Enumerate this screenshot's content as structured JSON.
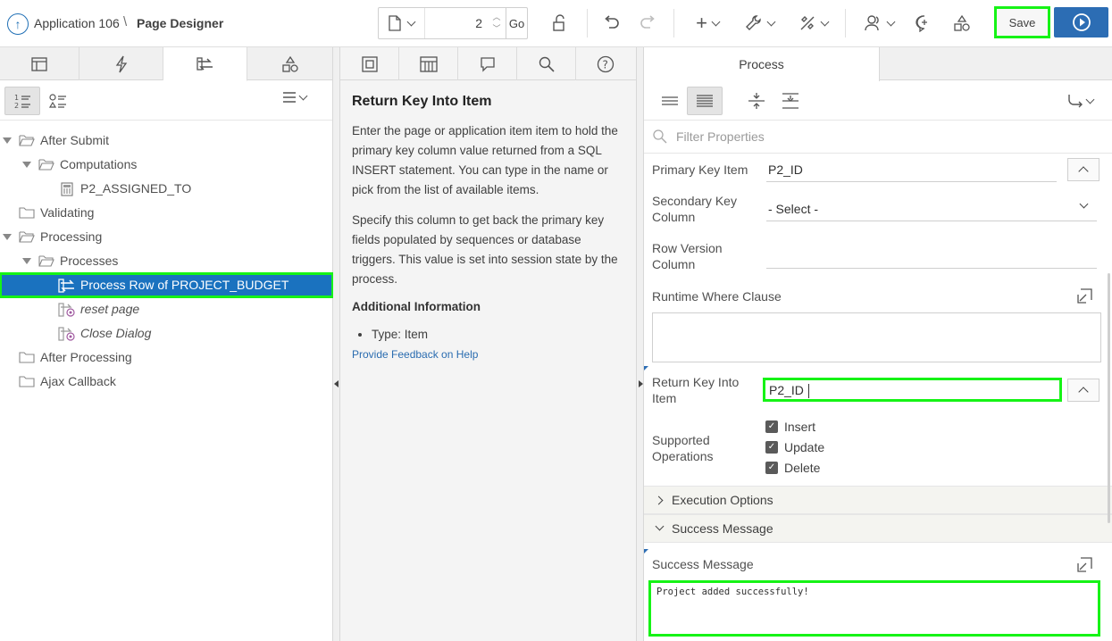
{
  "header": {
    "app_name": "Application 106",
    "separator": "\\",
    "page_title": "Page Designer",
    "page_number": "2",
    "go_label": "Go",
    "save_label": "Save"
  },
  "left": {
    "tree": [
      {
        "label": "After Submit",
        "level": 0,
        "icon": "folder-open-icon",
        "expanded": true
      },
      {
        "label": "Computations",
        "level": 1,
        "icon": "folder-open-icon",
        "expanded": true
      },
      {
        "label": "P2_ASSIGNED_TO",
        "level": 2,
        "icon": "calculator-icon"
      },
      {
        "label": "Validating",
        "level": 0,
        "icon": "folder-icon"
      },
      {
        "label": "Processing",
        "level": 0,
        "icon": "folder-open-icon",
        "expanded": true
      },
      {
        "label": "Processes",
        "level": 1,
        "icon": "folder-open-icon",
        "expanded": true
      },
      {
        "label": "Process Row of PROJECT_BUDGET",
        "level": 2,
        "icon": "process-icon",
        "selected": true
      },
      {
        "label": "reset page",
        "level": 2,
        "icon": "process-conditional-icon",
        "italic": true
      },
      {
        "label": "Close Dialog",
        "level": 2,
        "icon": "process-conditional-icon",
        "italic": true
      },
      {
        "label": "After Processing",
        "level": 0,
        "icon": "folder-icon"
      },
      {
        "label": "Ajax Callback",
        "level": 0,
        "icon": "folder-icon"
      }
    ]
  },
  "help": {
    "title": "Return Key Into Item",
    "paragraph1": "Enter the page or application item item to hold the primary key column value returned from a SQL INSERT statement. You can type in the name or pick from the list of available items.",
    "paragraph2": "Specify this column to get back the primary key fields populated by sequences or database triggers. This value is set into session state by the process.",
    "additional_heading": "Additional Information",
    "type_item": "Type: Item",
    "feedback_link": "Provide Feedback on Help"
  },
  "props": {
    "tab_label": "Process",
    "filter_placeholder": "Filter Properties",
    "primary_key_item_label": "Primary Key Item",
    "primary_key_item_value": "P2_ID",
    "secondary_key_label": "Secondary Key Column",
    "secondary_key_value": "- Select -",
    "row_version_label": "Row Version Column",
    "runtime_where_label": "Runtime Where Clause",
    "return_key_label": "Return Key Into Item",
    "return_key_value": "P2_ID",
    "supported_ops_label": "Supported Operations",
    "op_insert": "Insert",
    "op_update": "Update",
    "op_delete": "Delete",
    "execution_options": "Execution Options",
    "success_message_section": "Success Message",
    "success_message_label": "Success Message",
    "success_message_value": "Project added successfully!"
  },
  "colors": {
    "accent_blue": "#2c6db4",
    "selection_blue": "#1a72bf",
    "highlight_green": "#16f316"
  }
}
